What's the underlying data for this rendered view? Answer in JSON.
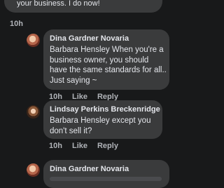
{
  "top_comment": {
    "text": "your business. I do now!",
    "time": "10h"
  },
  "comments": [
    {
      "author": "Dina Gardner Novaria",
      "text": "Barbara Hensley  When you're a business owner, you should have the same standards for all.. Just saying ~",
      "time": "10h",
      "like_label": "Like",
      "reply_label": "Reply"
    },
    {
      "author": "Lindsay Perkins Breckenridge",
      "text": "Barbara Hensley except you don't sell it?",
      "time": "10h",
      "like_label": "Like",
      "reply_label": "Reply"
    },
    {
      "author": "Dina Gardner Novaria",
      "text": ""
    }
  ],
  "colors": {
    "background": "#18191a",
    "bubble": "#3a3b3c",
    "text": "#e4e6eb",
    "muted": "#b0b3b8"
  }
}
